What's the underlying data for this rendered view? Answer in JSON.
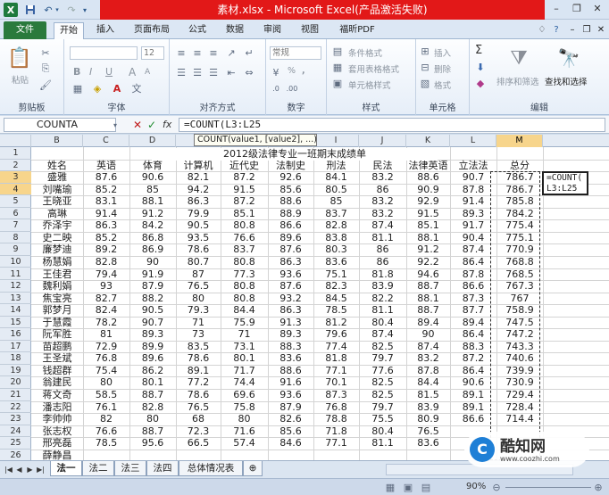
{
  "app": {
    "window_title": "素材.xlsx - Microsoft Excel(产品激活失败)",
    "icons": {
      "excel": "excel-app-icon",
      "save": "save-icon",
      "undo": "undo-icon",
      "redo": "redo-icon"
    }
  },
  "tabs": [
    "文件",
    "开始",
    "插入",
    "页面布局",
    "公式",
    "数据",
    "审阅",
    "视图",
    "福昕PDF"
  ],
  "ribbon": {
    "clipboard": {
      "label": "剪贴板",
      "paste": "粘贴"
    },
    "font": {
      "label": "字体",
      "size": "12",
      "bold": "B",
      "italic": "I",
      "underline": "U",
      "grow": "A",
      "shrink": "A"
    },
    "alignment": {
      "label": "对齐方式"
    },
    "number": {
      "label": "数字",
      "format": "常规",
      "percent": "%",
      "comma": ","
    },
    "styles": {
      "label": "样式",
      "cond": "条件格式",
      "table": "套用表格格式",
      "cell": "单元格样式"
    },
    "cells": {
      "label": "单元格",
      "insert": "插入",
      "delete": "删除",
      "format": "格式"
    },
    "editing": {
      "label": "编辑",
      "sum": "Σ",
      "sort": "排序和筛选",
      "find": "查找和选择"
    }
  },
  "formula_bar": {
    "name_box": "COUNTA",
    "fx": "fx",
    "formula": "=COUNT(L3:L25",
    "tooltip": "COUNT(value1, [value2], ...)"
  },
  "columns": [
    "B",
    "C",
    "D",
    "E",
    "G",
    "H",
    "I",
    "J",
    "K",
    "L",
    "M"
  ],
  "rows": [
    "1",
    "2",
    "3",
    "4",
    "5",
    "6",
    "7",
    "8",
    "9",
    "10",
    "11",
    "12",
    "13",
    "14",
    "15",
    "16",
    "17",
    "18",
    "19",
    "20",
    "21",
    "22",
    "23",
    "24",
    "25",
    "26"
  ],
  "table": {
    "title": "2012级法律专业一班期末成绩单",
    "headers": [
      "姓名",
      "英语",
      "体育",
      "计算机",
      "近代史",
      "法制史",
      "刑法",
      "民法",
      "法律英语",
      "立法法",
      "总分"
    ],
    "rows": [
      [
        "盛雅",
        "87.6",
        "90.6",
        "82.1",
        "87.2",
        "92.6",
        "84.1",
        "83.2",
        "88.6",
        "90.7",
        "786.7"
      ],
      [
        "刘嘴瑜",
        "85.2",
        "85",
        "94.2",
        "91.5",
        "85.6",
        "80.5",
        "86",
        "90.9",
        "87.8",
        "786.7"
      ],
      [
        "王晓亚",
        "83.1",
        "88.1",
        "86.3",
        "87.2",
        "88.6",
        "85",
        "83.2",
        "92.9",
        "91.4",
        "785.8"
      ],
      [
        "高琳",
        "91.4",
        "91.2",
        "79.9",
        "85.1",
        "88.9",
        "83.7",
        "83.2",
        "91.5",
        "89.3",
        "784.2"
      ],
      [
        "乔泽宇",
        "86.3",
        "84.2",
        "90.5",
        "80.8",
        "86.6",
        "82.8",
        "87.4",
        "85.1",
        "91.7",
        "775.4"
      ],
      [
        "史二映",
        "85.2",
        "86.8",
        "93.5",
        "76.6",
        "89.6",
        "83.8",
        "81.1",
        "88.1",
        "90.4",
        "775.1"
      ],
      [
        "廉梦迪",
        "89.2",
        "86.9",
        "78.6",
        "83.7",
        "87.6",
        "80.3",
        "86",
        "91.2",
        "87.4",
        "770.9"
      ],
      [
        "杨慧娟",
        "82.8",
        "90",
        "80.7",
        "80.8",
        "86.3",
        "83.6",
        "86",
        "92.2",
        "86.4",
        "768.8"
      ],
      [
        "王佳君",
        "79.4",
        "91.9",
        "87",
        "77.3",
        "93.6",
        "75.1",
        "81.8",
        "94.6",
        "87.8",
        "768.5"
      ],
      [
        "魏利娟",
        "93",
        "87.9",
        "76.5",
        "80.8",
        "87.6",
        "82.3",
        "83.9",
        "88.7",
        "86.6",
        "767.3"
      ],
      [
        "焦宝亮",
        "82.7",
        "88.2",
        "80",
        "80.8",
        "93.2",
        "84.5",
        "82.2",
        "88.1",
        "87.3",
        "767"
      ],
      [
        "郭梦月",
        "82.4",
        "90.5",
        "79.3",
        "84.4",
        "86.3",
        "78.5",
        "81.1",
        "88.7",
        "87.7",
        "758.9"
      ],
      [
        "于慧霞",
        "78.2",
        "90.7",
        "71",
        "75.9",
        "91.3",
        "81.2",
        "80.4",
        "89.4",
        "89.4",
        "747.5"
      ],
      [
        "阮军胜",
        "81",
        "89.3",
        "73",
        "71",
        "89.3",
        "79.6",
        "87.4",
        "90",
        "86.4",
        "747.2"
      ],
      [
        "苗超鹏",
        "72.9",
        "89.9",
        "83.5",
        "73.1",
        "88.3",
        "77.4",
        "82.5",
        "87.4",
        "88.3",
        "743.3"
      ],
      [
        "王圣斌",
        "76.8",
        "89.6",
        "78.6",
        "80.1",
        "83.6",
        "81.8",
        "79.7",
        "83.2",
        "87.2",
        "740.6"
      ],
      [
        "钱超群",
        "75.4",
        "86.2",
        "89.1",
        "71.7",
        "88.6",
        "77.1",
        "77.6",
        "87.8",
        "86.4",
        "739.9"
      ],
      [
        "翁建民",
        "80",
        "80.1",
        "77.2",
        "74.4",
        "91.6",
        "70.1",
        "82.5",
        "84.4",
        "90.6",
        "730.9"
      ],
      [
        "蒋文奇",
        "58.5",
        "88.7",
        "78.6",
        "69.6",
        "93.6",
        "87.3",
        "82.5",
        "81.5",
        "89.1",
        "729.4"
      ],
      [
        "潘志阳",
        "76.1",
        "82.8",
        "76.5",
        "75.8",
        "87.9",
        "76.8",
        "79.7",
        "83.9",
        "89.1",
        "728.4"
      ],
      [
        "李帅帅",
        "82",
        "80",
        "68",
        "80",
        "82.6",
        "78.8",
        "75.5",
        "80.9",
        "86.6",
        "714.4"
      ],
      [
        "张志权",
        "76.6",
        "88.7",
        "72.3",
        "71.6",
        "85.6",
        "71.8",
        "80.4",
        "76.5",
        "",
        ""
      ],
      [
        "邢亮磊",
        "78.5",
        "95.6",
        "66.5",
        "57.4",
        "84.6",
        "77.1",
        "81.1",
        "83.6",
        "",
        ""
      ],
      [
        "薛静昌",
        "",
        "",
        "",
        "",
        "",
        "",
        "",
        "",
        "",
        ""
      ]
    ]
  },
  "active_cell": {
    "line1": "=COUNT(",
    "line2": "L3:L25"
  },
  "sheets": [
    "法一",
    "法二",
    "法三",
    "法四",
    "总体情况表"
  ],
  "status": {
    "zoom": "90%"
  },
  "watermark": {
    "name": "酷知网",
    "url": "www.coozhi.com"
  }
}
